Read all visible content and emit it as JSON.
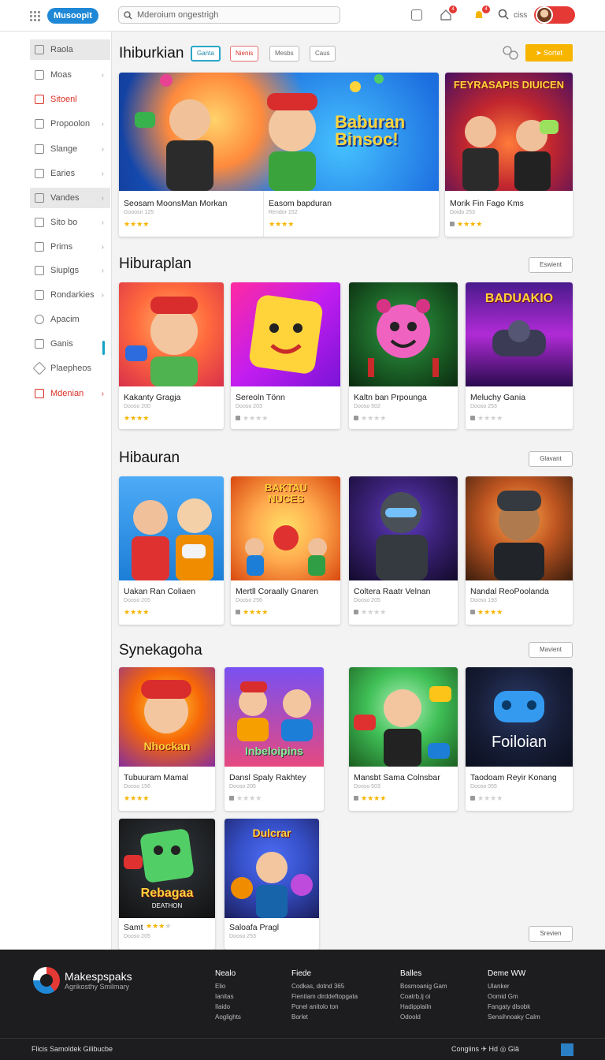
{
  "header": {
    "logo": "Musoopit",
    "search_placeholder": "Mderoium ongestrigh",
    "notif_count_1": "4",
    "notif_count_2": "4",
    "user_label": "ciss"
  },
  "sidebar": {
    "items": [
      {
        "label": "Raola"
      },
      {
        "label": "Moas"
      },
      {
        "label": "Sitoenl"
      },
      {
        "label": "Propoolon"
      },
      {
        "label": "Slange"
      },
      {
        "label": "Earies"
      },
      {
        "label": "Vandes"
      },
      {
        "label": "Sito bo"
      },
      {
        "label": "Prims"
      },
      {
        "label": "Siuplgs"
      },
      {
        "label": "Rondarkies"
      },
      {
        "label": "Apacim"
      },
      {
        "label": "Ganis"
      },
      {
        "label": "Plaepheos"
      },
      {
        "label": "Mdenian"
      }
    ]
  },
  "section1": {
    "title": "Ihiburkian",
    "chips": [
      "Ganta",
      "Nienis",
      "Mesbs",
      "Caus"
    ],
    "sort_label": "Sortet",
    "cards": [
      {
        "banner": "Baburan Binsoc!",
        "title": "Seosam MoonsMan Morkan",
        "sub": "Gooosn 125"
      },
      {
        "banner": "",
        "title": "Easom bapduran",
        "sub": "Rendor 152"
      },
      {
        "banner": "FEYRASAPIS DIUICEN",
        "title": "Morik Fin Fago Kms",
        "sub": "Doido 253"
      }
    ]
  },
  "section2": {
    "title": "Hiburaplan",
    "button": "Eswient",
    "cards": [
      {
        "banner": "",
        "title": "Kakanty Gragja",
        "sub": "Dooso 200"
      },
      {
        "banner": "",
        "title": "Sereoln Tönn",
        "sub": "Dooso 203"
      },
      {
        "banner": "",
        "title": "Kaltn ban Prpounga",
        "sub": "Dooso 502"
      },
      {
        "banner": "BADUAKIO",
        "title": "Meluchy Gania",
        "sub": "Dooso 253"
      }
    ]
  },
  "section3": {
    "title": "Hibauran",
    "button": "Glavant",
    "cards": [
      {
        "banner": "",
        "title": "Uakan Ran Coliaen",
        "sub": "Dooso 205"
      },
      {
        "banner": "BAKTAU NUCES",
        "title": "Mertll Coraally Gnaren",
        "sub": "Dooso 256"
      },
      {
        "banner": "",
        "title": "Coltera Raatr Velnan",
        "sub": "Dooso 205"
      },
      {
        "banner": "",
        "title": "Nandal ReoPoolanda",
        "sub": "Dooso 193"
      }
    ]
  },
  "section4": {
    "title": "Synekagoha",
    "button": "Mavient",
    "cards": [
      {
        "banner": "Nhockan",
        "title": "Tubuuram Mamal",
        "sub": "Dooso 156"
      },
      {
        "banner": "Inbeloipins",
        "title": "Dansl Spaly Rakhtey",
        "sub": "Dooso 205"
      },
      {
        "banner": "",
        "title": "Mansbt Sama Colnsbar",
        "sub": "Dooso 503"
      },
      {
        "banner": "Foiloian",
        "title": "Taodoam Reyir Konang",
        "sub": "Dooso 055"
      },
      {
        "banner": "Rebagaa",
        "sub_banner": "DEATHON",
        "title": "Samt",
        "sub": "Dooso 205"
      },
      {
        "banner": "Dulcrar",
        "title": "Saloafa Pragl",
        "sub": "Dooso 253"
      }
    ],
    "page_button": "Srevien"
  },
  "footer": {
    "brand": "Makespspaks",
    "tagline": "Agrikosthy Smilmary",
    "columns": [
      {
        "heading": "Nealo",
        "links": [
          "Elio",
          "Ianitas",
          "Ilaido",
          "Aoglights"
        ]
      },
      {
        "heading": "Fiede",
        "links": [
          "Codkas, dotnd 365",
          "Fienitam dirddeftopgata",
          "Ponel anitolo ton",
          "Borlet"
        ]
      },
      {
        "heading": "Balles",
        "links": [
          "Bosmoanig Gam",
          "Coatrb,lj oi",
          "Hadipplailn",
          "Odoold"
        ]
      },
      {
        "heading": "Deme WW",
        "links": [
          "Ulanker",
          "Oomid Gm",
          "Fangaty dlsobk",
          "Sensihnoaky Calm"
        ]
      }
    ],
    "bottom_left": "Flicis Samoldek Gilibucbe",
    "bottom_right": "Congiins ✈ Hd ◎ Glä"
  }
}
